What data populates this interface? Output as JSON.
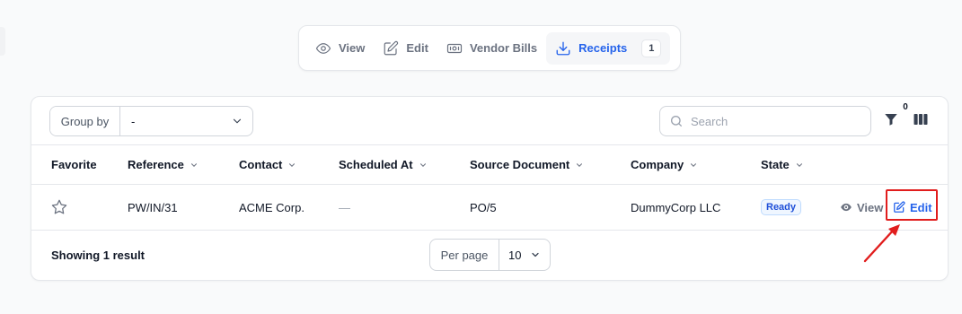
{
  "tabs": [
    {
      "label": "View",
      "icon": "eye-icon"
    },
    {
      "label": "Edit",
      "icon": "pencil-square-icon"
    },
    {
      "label": "Vendor Bills",
      "icon": "banknote-icon"
    },
    {
      "label": "Receipts",
      "icon": "download-icon",
      "count": "1",
      "active": true
    }
  ],
  "toolbar": {
    "group_by_label": "Group by",
    "group_by_value": "-",
    "search_placeholder": "Search",
    "filter_count": "0"
  },
  "table": {
    "columns": [
      "Favorite",
      "Reference",
      "Contact",
      "Scheduled At",
      "Source Document",
      "Company",
      "State"
    ],
    "rows": [
      {
        "reference": "PW/IN/31",
        "contact": "ACME Corp.",
        "scheduled_at": "—",
        "source_document": "PO/5",
        "company": "DummyCorp LLC",
        "state": "Ready",
        "view_label": "View",
        "edit_label": "Edit"
      }
    ]
  },
  "footer": {
    "showing": "Showing 1 result",
    "per_page_label": "Per page",
    "per_page_value": "10"
  },
  "colors": {
    "accent": "#2563eb",
    "highlight": "#e11d1d",
    "ready_badge_bg": "#eff6ff"
  }
}
